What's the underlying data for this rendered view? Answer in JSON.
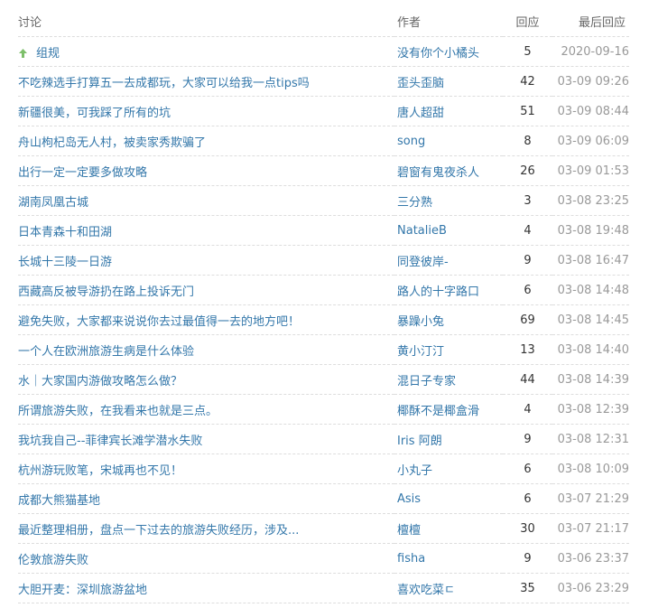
{
  "header": {
    "title": "讨论",
    "author": "作者",
    "replies": "回应",
    "last_reply": "最后回应"
  },
  "rows": [
    {
      "title": "组规",
      "author": "没有你个小橘头",
      "replies": "5",
      "time": "2020-09-16",
      "pinned": true
    },
    {
      "title": "不吃辣选手打算五一去成都玩，大家可以给我一点tips吗",
      "author": "歪头歪脑",
      "replies": "42",
      "time": "03-09 09:26"
    },
    {
      "title": "新疆很美，可我踩了所有的坑",
      "author": "唐人超甜",
      "replies": "51",
      "time": "03-09 08:44"
    },
    {
      "title": "舟山枸杞岛无人村，被卖家秀欺骗了",
      "author": "song",
      "replies": "8",
      "time": "03-09 06:09"
    },
    {
      "title": "出行一定一定要多做攻略",
      "author": "碧窗有鬼夜杀人",
      "replies": "26",
      "time": "03-09 01:53"
    },
    {
      "title": "湖南凤凰古城",
      "author": "三分熟",
      "replies": "3",
      "time": "03-08 23:25"
    },
    {
      "title": "日本青森十和田湖",
      "author": "NatalieB",
      "replies": "4",
      "time": "03-08 19:48"
    },
    {
      "title": "长城十三陵一日游",
      "author": "同登彼岸-",
      "replies": "9",
      "time": "03-08 16:47"
    },
    {
      "title": "西藏高反被导游扔在路上投诉无门",
      "author": "路人的十字路口",
      "replies": "6",
      "time": "03-08 14:48"
    },
    {
      "title": "避免失败，大家都来说说你去过最值得一去的地方吧！",
      "author": "暴躁小兔",
      "replies": "69",
      "time": "03-08 14:45"
    },
    {
      "title": "一个人在欧洲旅游生病是什么体验",
      "author": "黄小汀汀",
      "replies": "13",
      "time": "03-08 14:40"
    },
    {
      "title": "水｜大家国内游做攻略怎么做？",
      "author": "混日子专家",
      "replies": "44",
      "time": "03-08 14:39"
    },
    {
      "title": "所谓旅游失败，在我看来也就是三点。",
      "author": "椰酥不是椰盒滑",
      "replies": "4",
      "time": "03-08 12:39"
    },
    {
      "title": "我坑我自己--菲律宾长滩学潜水失败",
      "author": "Iris 阿朗",
      "replies": "9",
      "time": "03-08 12:31"
    },
    {
      "title": "杭州游玩败笔，宋城再也不见！",
      "author": "小丸子",
      "replies": "6",
      "time": "03-08 10:09"
    },
    {
      "title": "成都大熊猫基地",
      "author": "Asis",
      "replies": "6",
      "time": "03-07 21:29"
    },
    {
      "title": "最近整理相册，盘点一下过去的旅游失败经历，涉及...",
      "author": "檀檀",
      "replies": "30",
      "time": "03-07 21:17"
    },
    {
      "title": "伦敦旅游失败",
      "author": "fisha",
      "replies": "9",
      "time": "03-06 23:37"
    },
    {
      "title": "大胆开麦：深圳旅游盆地",
      "author": "喜欢吃菜ㄷ",
      "replies": "35",
      "time": "03-06 23:29"
    }
  ],
  "icons": {
    "pin": "pin-up-arrow-icon",
    "pin_color": "#7dbf6a"
  },
  "colors": {
    "link": "#3377aa",
    "time": "#999999"
  }
}
